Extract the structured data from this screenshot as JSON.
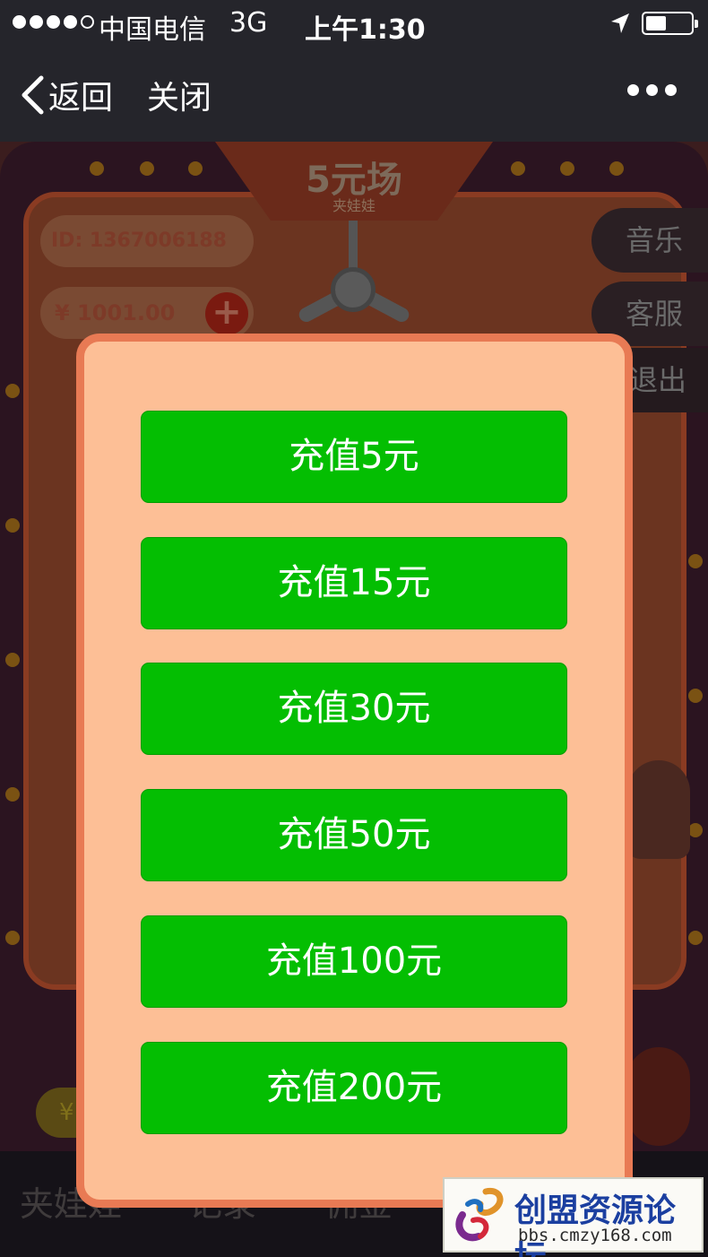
{
  "status_bar": {
    "carrier": "中国电信",
    "network": "3G",
    "time": "上午1:30"
  },
  "nav_bar": {
    "back_label": "返回",
    "close_label": "关闭"
  },
  "game": {
    "title": "5元场",
    "subtitle": "夹娃娃",
    "user_id": "ID: 1367006188",
    "balance": "¥ 1001.00",
    "side_buttons": {
      "music": "音乐",
      "service": "客服",
      "exit": "退出"
    },
    "bottom_tabs": {
      "tab1": "夹娃娃",
      "tab2": "记录",
      "tab3": "佣金"
    },
    "coin_symbol": "¥"
  },
  "recharge_modal": {
    "options": [
      {
        "label": "充值5元"
      },
      {
        "label": "充值15元"
      },
      {
        "label": "充值30元"
      },
      {
        "label": "充值50元"
      },
      {
        "label": "充值100元"
      },
      {
        "label": "充值200元"
      }
    ],
    "button_color": "#04be02",
    "panel_color": "#fdbf96",
    "border_color": "#e87a54"
  },
  "watermark": {
    "title": "创盟资源论坛",
    "url": "bbs.cmzy168.com"
  }
}
